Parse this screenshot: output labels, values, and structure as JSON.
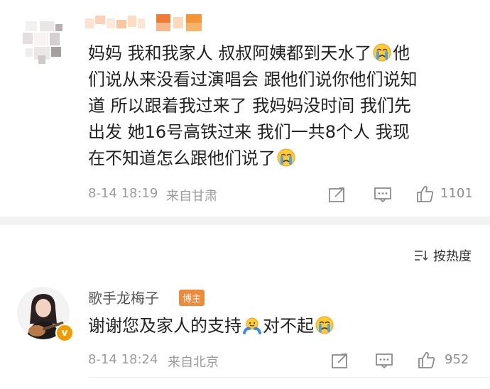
{
  "comment1": {
    "avatar_icon": "pixelated-avatar",
    "username_icon": "pixelated-username",
    "text_line1": "妈妈 我和我家人 叔叔阿姨都到天水了",
    "text_line1b": "他",
    "text_line2": "们说从来没看过演唱会 跟他们说你他们说知",
    "text_line3": "道 所以跟着我过来了 我妈妈没时间 我们先",
    "text_line4": "出发 她16号高铁过来 我们一共8个人 我现",
    "text_line5": "在不知道怎么跟他们说了",
    "emoji": "crying-face-emoji",
    "time": "8-14 18:19",
    "location": "来自甘肃",
    "likes": "1101"
  },
  "sort": {
    "label": "按热度"
  },
  "comment2": {
    "username": "歌手龙梅子",
    "tag": "博主",
    "verified": "v",
    "text_a": "谢谢您及家人的支持",
    "text_b": "对不起",
    "time": "8-14 18:24",
    "location": "来自北京",
    "likes": "952"
  },
  "colors": {
    "meta": "#9b9b9b",
    "tag": "#f08a3b",
    "vbadge": "#f39a00",
    "divider": "#f2f2f2"
  }
}
